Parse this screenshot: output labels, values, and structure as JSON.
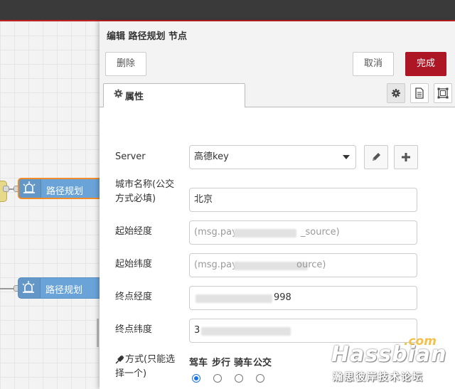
{
  "workspace": {
    "nodes": [
      {
        "label": "路径规划",
        "selected": true
      },
      {
        "label": "路径规划",
        "selected": false
      }
    ]
  },
  "tray": {
    "title": "编辑 路径规划 节点",
    "buttons": {
      "delete": "删除",
      "cancel": "取消",
      "done": "完成"
    },
    "tab": {
      "label": "属性",
      "icon": "gear-icon"
    },
    "tab_tools": [
      "gear-icon",
      "document-icon",
      "frame-icon"
    ]
  },
  "form": {
    "server": {
      "label": "Server",
      "value": "高德key",
      "edit_icon": "pencil-icon",
      "add_icon": "plus-icon"
    },
    "city": {
      "label_line1": "城市名称(公交",
      "label_line2": "方式必填)",
      "value": "北京"
    },
    "start_lng": {
      "label": "起始经度",
      "placeholder_visible": "(msg.pay",
      "placeholder_tail": "_source)"
    },
    "start_lat": {
      "label": "起始纬度",
      "placeholder_visible": "(msg.pay",
      "placeholder_tail": "ource)"
    },
    "end_lng": {
      "label": "终点经度",
      "value_tail": "998"
    },
    "end_lat": {
      "label": "终点纬度",
      "value_head": "3"
    },
    "mode": {
      "label_line1": "方式(只能选",
      "label_line2": "择一个)",
      "icon": "plug-icon",
      "options": [
        "驾车",
        "步行",
        "骑车",
        "公交"
      ],
      "selected_index": 0
    }
  },
  "watermark": {
    "com": ".com",
    "brand": "Hassbian",
    "site": "瀚思彼岸技术论坛"
  },
  "colors": {
    "accent": "#ad1625",
    "node": "#6aa3d8",
    "selected_border": "#f08c28",
    "radio": "#1a73e8"
  }
}
